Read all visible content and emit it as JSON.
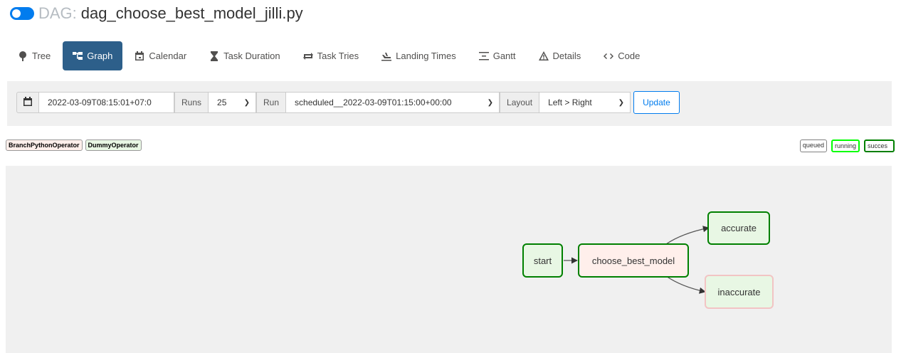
{
  "header": {
    "prefix": "DAG:",
    "dag_name": "dag_choose_best_model_jilli.py"
  },
  "nav": {
    "items": [
      {
        "label": "Tree",
        "icon": "tree-icon"
      },
      {
        "label": "Graph",
        "icon": "graph-icon",
        "active": true
      },
      {
        "label": "Calendar",
        "icon": "calendar-icon"
      },
      {
        "label": "Task Duration",
        "icon": "hourglass-icon"
      },
      {
        "label": "Task Tries",
        "icon": "retry-icon"
      },
      {
        "label": "Landing Times",
        "icon": "landing-icon"
      },
      {
        "label": "Gantt",
        "icon": "gantt-icon"
      },
      {
        "label": "Details",
        "icon": "warning-icon"
      },
      {
        "label": "Code",
        "icon": "code-icon"
      }
    ]
  },
  "toolbar": {
    "date_value": "2022-03-09T08:15:01+07:0",
    "runs_label": "Runs",
    "runs_value": "25",
    "run_label": "Run",
    "run_value": "scheduled__2022-03-09T01:15:00+00:00",
    "layout_label": "Layout",
    "layout_value": "Left > Right",
    "update_label": "Update"
  },
  "legend": {
    "operators": [
      {
        "label": "BranchPythonOperator",
        "color": "#ffefeb"
      },
      {
        "label": "DummyOperator",
        "color": "#e8f7e4"
      }
    ],
    "states": [
      {
        "label": "queued",
        "color": "#808080"
      },
      {
        "label": "running",
        "color": "#00ff00"
      },
      {
        "label": "succes",
        "color": "#008000"
      }
    ]
  },
  "graph": {
    "nodes": [
      {
        "label": "start",
        "operator": "DummyOperator",
        "state_color": "#008000"
      },
      {
        "label": "choose_best_model",
        "operator": "BranchPythonOperator",
        "state_color": "#008000"
      },
      {
        "label": "accurate",
        "operator": "DummyOperator",
        "state_color": "#008000"
      },
      {
        "label": "inaccurate",
        "operator": "DummyOperator",
        "state_color": "#ffc0cb"
      }
    ]
  }
}
